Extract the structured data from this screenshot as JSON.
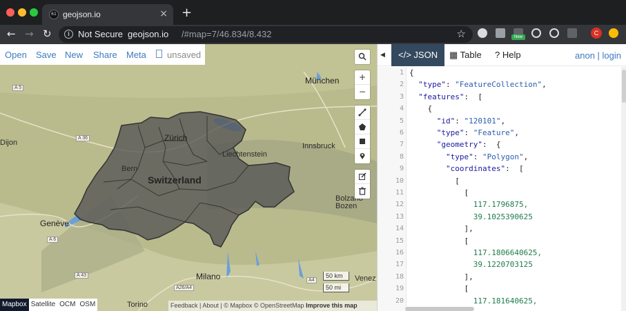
{
  "browser": {
    "tab_title": "geojson.io",
    "favicon_text": "61",
    "not_secure": "Not Secure",
    "url_host": "geojson.io",
    "url_path": "/#map=7/46.834/8.432",
    "new_tab": "+",
    "profile_initial": "C",
    "extension_badge": "New"
  },
  "file_menu": {
    "items": [
      "Open",
      "Save",
      "New",
      "Share",
      "Meta"
    ],
    "status": "unsaved"
  },
  "map": {
    "country_label": "Switzerland",
    "cities": [
      {
        "name": "München",
        "kind": "city"
      },
      {
        "name": "Zürich",
        "kind": "city"
      },
      {
        "name": "Liechtenstein",
        "kind": "label"
      },
      {
        "name": "Innsbruck",
        "kind": "label"
      },
      {
        "name": "Bern",
        "kind": "label"
      },
      {
        "name": "Genève",
        "kind": "city"
      },
      {
        "name": "Dijon",
        "kind": "label"
      },
      {
        "name": "Bolzano Bozen",
        "kind": "label"
      },
      {
        "name": "Milano",
        "kind": "city"
      },
      {
        "name": "Torino",
        "kind": "label"
      },
      {
        "name": "Venez",
        "kind": "label"
      }
    ],
    "roads": [
      "A 5",
      "A 36",
      "A 6",
      "A 43",
      "A26/A4",
      "A4"
    ],
    "scale": {
      "km": "50 km",
      "mi": "50 mi"
    },
    "layers": [
      {
        "label": "Mapbox",
        "active": true
      },
      {
        "label": "Satellite",
        "active": false
      },
      {
        "label": "OCM",
        "active": false
      },
      {
        "label": "OSM",
        "active": false
      }
    ],
    "attribution": {
      "links": "Feedback | About | © Mapbox © OpenStreetMap",
      "improve": "Improve this map"
    },
    "controls": {
      "search": "search-icon",
      "zoom_in": "+",
      "zoom_out": "−",
      "draw": [
        "polyline-icon",
        "polygon-icon",
        "rectangle-icon",
        "marker-icon"
      ],
      "edit": [
        "edit-icon",
        "trash-icon"
      ]
    },
    "colors": {
      "country_fill": "#555555",
      "land": "#b9bb8c",
      "water": "#6aa0d8"
    }
  },
  "pane": {
    "collapse": "◀",
    "tabs": [
      {
        "label": "</> JSON",
        "active": true
      },
      {
        "label": "▦ Table",
        "active": false
      },
      {
        "label": "? Help",
        "active": false
      }
    ],
    "user": {
      "anon": "anon",
      "sep": " | ",
      "login": "login"
    },
    "accent": "#34495e"
  },
  "editor": {
    "lines": [
      {
        "n": "1",
        "indent": "",
        "text": "{",
        "kind": "p"
      },
      {
        "n": "2",
        "indent": "  ",
        "key": "\"type\"",
        "val": "\"FeatureCollection\"",
        "tail": ","
      },
      {
        "n": "3",
        "indent": "  ",
        "key": "\"features\"",
        "tail": " ["
      },
      {
        "n": "4",
        "indent": "    ",
        "text": "{",
        "kind": "p"
      },
      {
        "n": "5",
        "indent": "      ",
        "key": "\"id\"",
        "val": "\"120101\"",
        "tail": ","
      },
      {
        "n": "6",
        "indent": "      ",
        "key": "\"type\"",
        "val": "\"Feature\"",
        "tail": ","
      },
      {
        "n": "7",
        "indent": "      ",
        "key": "\"geometry\"",
        "tail": " {"
      },
      {
        "n": "8",
        "indent": "        ",
        "key": "\"type\"",
        "val": "\"Polygon\"",
        "tail": ","
      },
      {
        "n": "9",
        "indent": "        ",
        "key": "\"coordinates\"",
        "tail": " ["
      },
      {
        "n": "10",
        "indent": "          ",
        "text": "[",
        "kind": "p"
      },
      {
        "n": "11",
        "indent": "            ",
        "text": "[",
        "kind": "p"
      },
      {
        "n": "12",
        "indent": "              ",
        "text": "117.1796875,",
        "kind": "n"
      },
      {
        "n": "13",
        "indent": "              ",
        "text": "39.1025390625",
        "kind": "n"
      },
      {
        "n": "14",
        "indent": "            ",
        "text": "],",
        "kind": "p"
      },
      {
        "n": "15",
        "indent": "            ",
        "text": "[",
        "kind": "p"
      },
      {
        "n": "16",
        "indent": "              ",
        "text": "117.1806640625,",
        "kind": "n"
      },
      {
        "n": "17",
        "indent": "              ",
        "text": "39.1220703125",
        "kind": "n"
      },
      {
        "n": "18",
        "indent": "            ",
        "text": "],",
        "kind": "p"
      },
      {
        "n": "19",
        "indent": "            ",
        "text": "[",
        "kind": "p"
      },
      {
        "n": "20",
        "indent": "              ",
        "text": "117.181640625,",
        "kind": "n"
      }
    ]
  }
}
